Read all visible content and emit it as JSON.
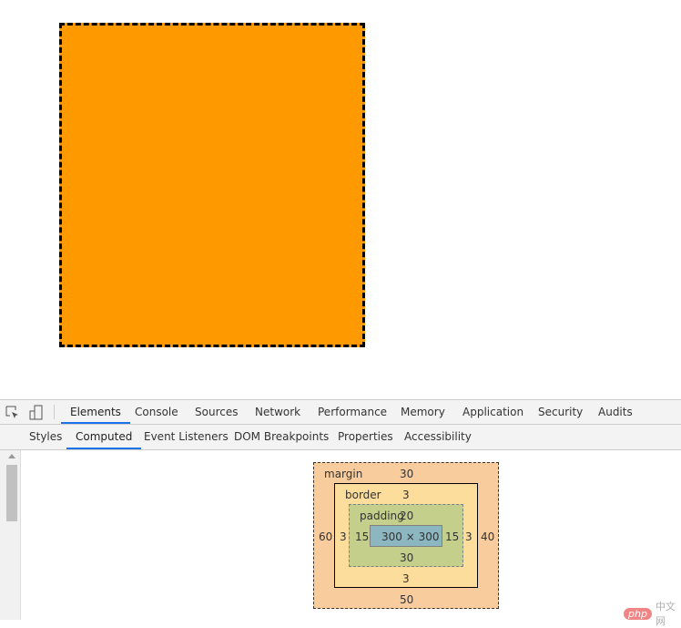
{
  "page": {
    "box_color": "#ff9900"
  },
  "devtools": {
    "main_tabs": [
      "Elements",
      "Console",
      "Sources",
      "Network",
      "Performance",
      "Memory",
      "Application",
      "Security",
      "Audits"
    ],
    "main_selected": "Elements",
    "sub_tabs": [
      "Styles",
      "Computed",
      "Event Listeners",
      "DOM Breakpoints",
      "Properties",
      "Accessibility"
    ],
    "sub_selected": "Computed",
    "icons": [
      "inspect-element-icon",
      "device-toolbar-icon"
    ],
    "box_model": {
      "margin": {
        "label": "margin",
        "top": "30",
        "right": "40",
        "bottom": "50",
        "left": "60"
      },
      "border": {
        "label": "border",
        "top": "3",
        "right": "3",
        "bottom": "3",
        "left": "3"
      },
      "padding": {
        "label": "padding",
        "top": "20",
        "right": "15",
        "bottom": "30",
        "left": "15"
      },
      "content": "300 × 300"
    }
  },
  "watermark": {
    "logo": "php",
    "text": "中文网"
  }
}
